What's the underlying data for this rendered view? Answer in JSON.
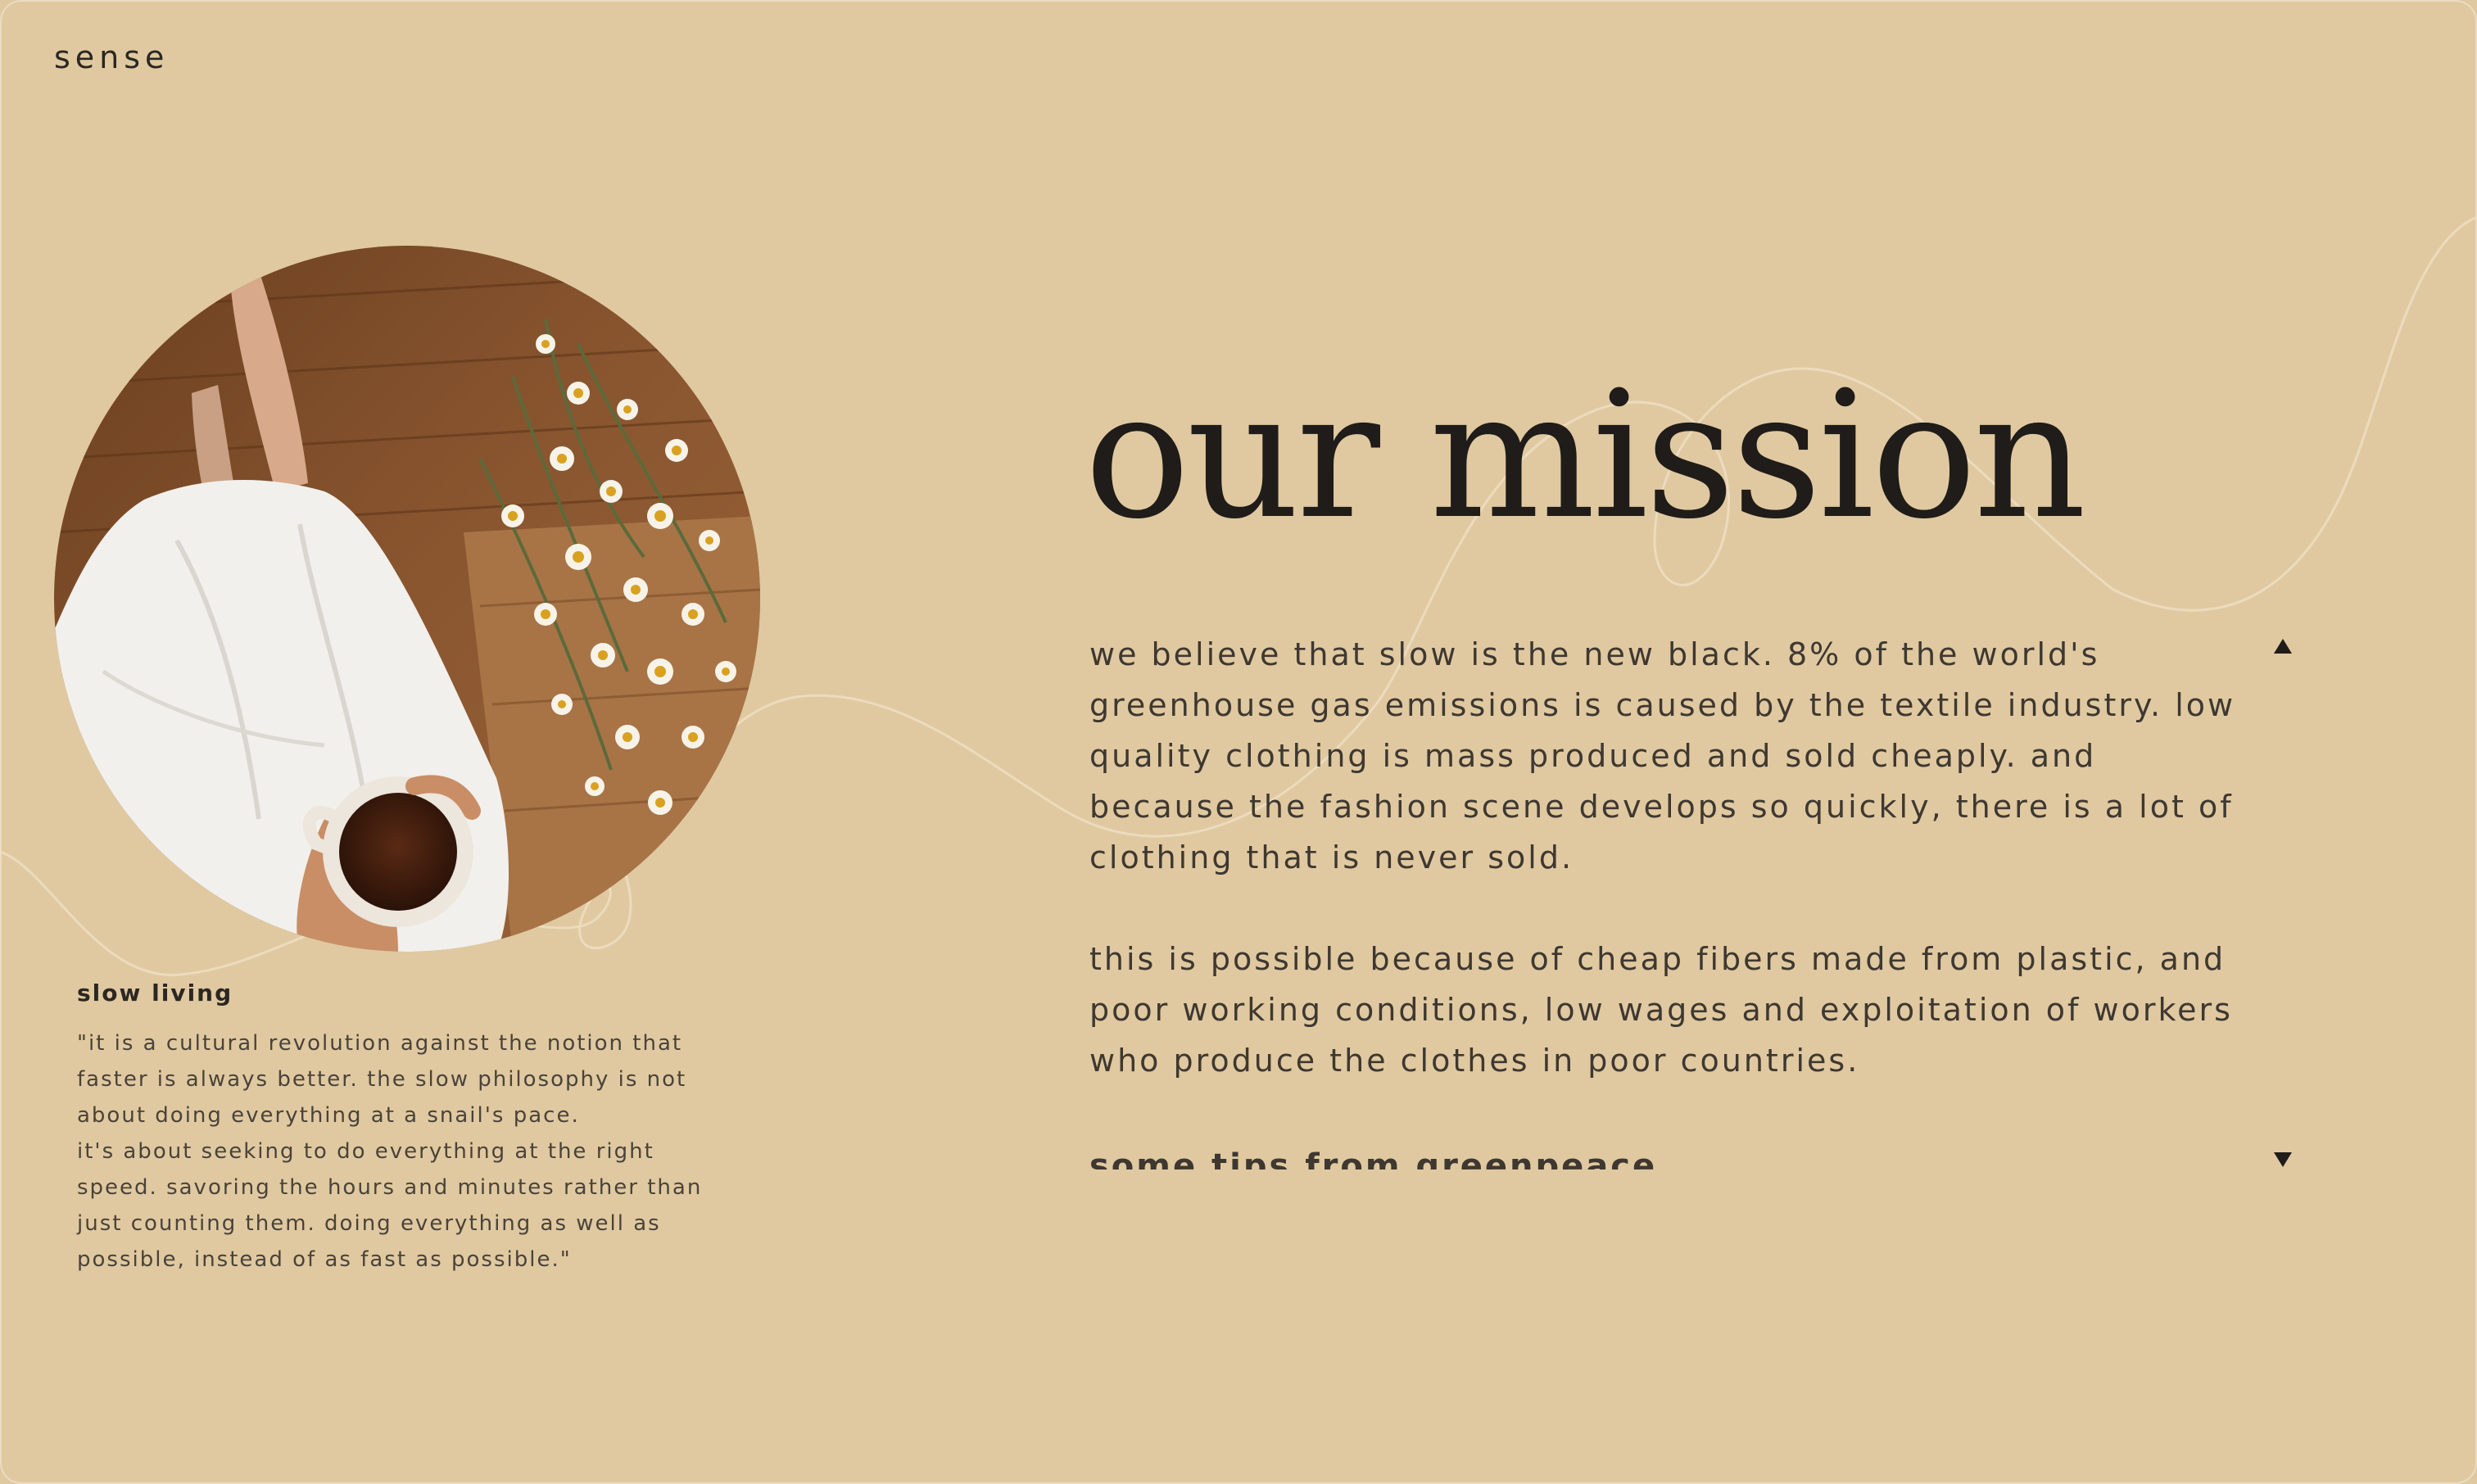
{
  "brand": {
    "logo": "sense"
  },
  "hero": {
    "photo_alt": "overhead photo of a person in a white dress holding a cup of coffee beside a bouquet of daisies on a wooden floor",
    "caption_title": "slow living",
    "caption_quote": "\"it is a cultural revolution against the notion that faster is always better. the slow philosophy is not about doing everything at a snail's pace.\nit's about seeking to do everything at the right speed. savoring the hours and minutes rather than just counting them. doing everything as well as possible, instead of as fast as possible.\""
  },
  "mission": {
    "title": "our mission",
    "paragraphs": [
      "we believe that slow is the new black. 8% of the world's greenhouse gas emissions is caused by the textile industry. low quality clothing is mass produced and sold cheaply. and because the fashion scene develops so quickly, there is a lot of clothing that is never sold.",
      "this is possible because of cheap fibers made from plastic, and poor working conditions, low wages and exploitation of workers who produce the clothes in poor countries."
    ],
    "tips_heading": "some tips from greenpeace"
  },
  "icons": {
    "scroll_up": "triangle-up-icon",
    "scroll_down": "triangle-down-icon"
  },
  "colors": {
    "background": "#e0c9a0",
    "text_dark": "#1f1c19",
    "text_body": "#3e3831",
    "decorative_line": "#efe0c6"
  }
}
